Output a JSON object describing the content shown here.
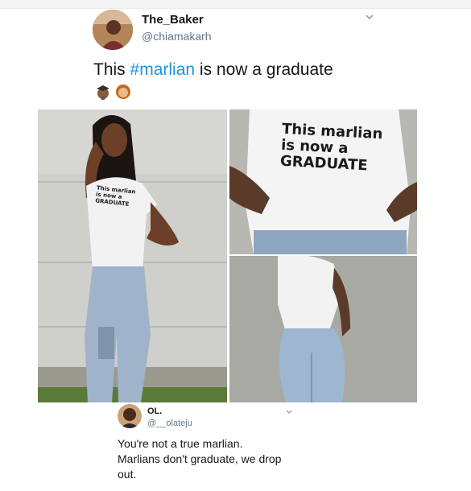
{
  "tweet": {
    "author_name": "The_Baker",
    "author_handle": "@chiamakarh",
    "text_before": "This ",
    "hashtag": "#marlian",
    "text_after": " is now a graduate",
    "emoji_icons": [
      "student-emoji-icon",
      "woman-emoji-icon"
    ]
  },
  "shirt": {
    "line1": "This marlian",
    "line2": "is now a",
    "line3": "GRADUATE"
  },
  "reply": {
    "author_name": "OL.",
    "author_handle": "@__olateju",
    "text_line1": "You're not a true marlian.",
    "text_line2": "Marlians don't graduate, we drop",
    "text_line3": "out."
  },
  "colors": {
    "hashtag": "#1b95e0",
    "secondary_text": "#657786"
  }
}
